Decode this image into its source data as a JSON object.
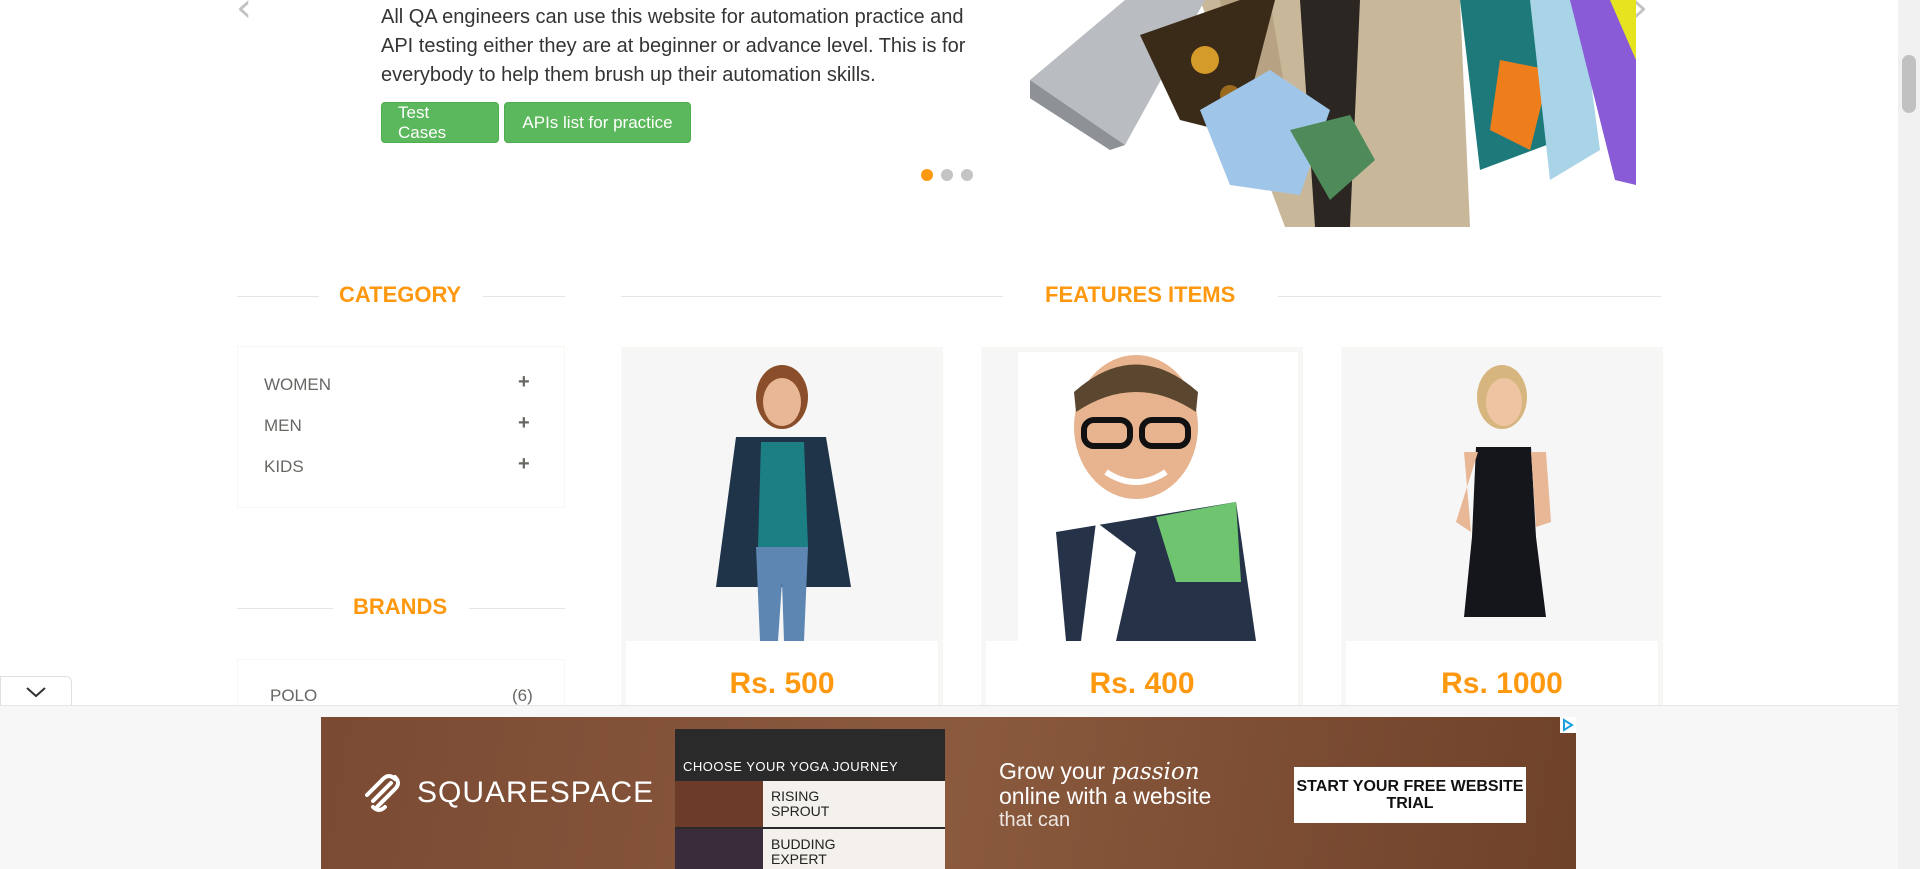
{
  "slider": {
    "description": "All QA engineers can use this website for automation practice and API testing either they are at beginner or advance level. This is for everybody to help them brush up their automation skills.",
    "buttons": {
      "test_cases": "Test Cases",
      "apis_list": "APIs list for practice"
    },
    "prev_glyph": "‹",
    "next_glyph": "›",
    "active_dot_index": 0,
    "dot_count": 3
  },
  "sidebar": {
    "category_title": "CATEGORY",
    "categories": [
      {
        "label": "WOMEN",
        "icon": "plus-icon"
      },
      {
        "label": "MEN",
        "icon": "plus-icon"
      },
      {
        "label": "KIDS",
        "icon": "plus-icon"
      }
    ],
    "brands_title": "BRANDS",
    "brands": [
      {
        "name": "POLO",
        "count": "(6)"
      }
    ]
  },
  "features": {
    "title": "FEATURES ITEMS",
    "products": [
      {
        "price": "Rs. 500"
      },
      {
        "price": "Rs. 400"
      },
      {
        "price": "Rs. 1000"
      }
    ]
  },
  "ad": {
    "brand": "SQUARESPACE",
    "screenshot_heading": "CHOOSE YOUR YOGA JOURNEY",
    "rows": [
      "RISING SPROUT",
      "BUDDING EXPERT"
    ],
    "copy_line1": "Grow your",
    "copy_italic": "passion",
    "copy_line2": "online with a website",
    "copy_line3": "that can",
    "cta": "START YOUR FREE WEBSITE TRIAL"
  },
  "colors": {
    "accent": "#fe980f",
    "button_green": "#5cb85c",
    "text": "#696763",
    "ad_bg": "#7a4a33"
  }
}
